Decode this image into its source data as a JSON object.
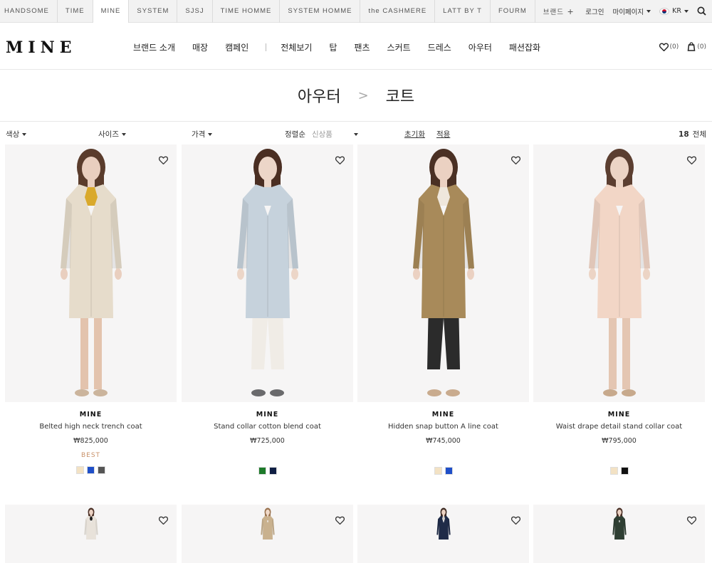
{
  "topbar": {
    "brands": [
      "HANDSOME",
      "TIME",
      "MINE",
      "SYSTEM",
      "SJSJ",
      "TIME HOMME",
      "SYSTEM HOMME",
      "the CASHMERE",
      "LATT BY T",
      "FOURM",
      "브랜드"
    ],
    "active_brand": "MINE",
    "login": "로그인",
    "mypage": "마이페이지",
    "lang": "KR"
  },
  "header": {
    "logo": "MINE",
    "nav_left": [
      "브랜드 소개",
      "매장",
      "캠페인"
    ],
    "nav_right": [
      "전체보기",
      "탑",
      "팬츠",
      "스커트",
      "드레스",
      "아우터",
      "패션잡화"
    ],
    "wish_count": "(0)",
    "cart_count": "(0)"
  },
  "breadcrumb": {
    "parent": "아우터",
    "separator": ">",
    "current": "코트"
  },
  "filters": {
    "color": "색상",
    "size": "사이즈",
    "price": "가격",
    "sort_label": "정렬순",
    "sort_value": "신상품",
    "reset": "초기화",
    "apply": "적용",
    "total_count": "18",
    "total_label": "전체"
  },
  "products": [
    {
      "brand": "MINE",
      "name": "Belted high neck trench coat",
      "price": "₩825,000",
      "badge": "BEST",
      "swatches": [
        "#f3e2c4",
        "#1f4fc8",
        "#555555"
      ],
      "garment": "#e6dccb",
      "inner": "#d9a92c",
      "legs": "#e3c3ad",
      "shoes": "#cbb49c",
      "skin": "#e9cfbf",
      "hair": "#5a3c2c",
      "pants": ""
    },
    {
      "brand": "MINE",
      "name": "Stand collar cotton blend coat",
      "price": "₩725,000",
      "badge": "",
      "swatches": [
        "#1d7a2a",
        "#0f1f44"
      ],
      "garment": "#c6d2dc",
      "inner": "#c6d2dc",
      "legs": "#f0ece6",
      "shoes": "#6a6a6c",
      "skin": "#ecd6c8",
      "hair": "#4a2e22",
      "pants": "#f0ece6"
    },
    {
      "brand": "MINE",
      "name": "Hidden snap button A line coat",
      "price": "₩745,000",
      "badge": "",
      "swatches": [
        "#f3e2c4",
        "#1f4fc8"
      ],
      "garment": "#a88a5a",
      "inner": "#efe7dc",
      "legs": "#2b2b2b",
      "shoes": "#c9ab8e",
      "skin": "#ebd1c2",
      "hair": "#4a3024",
      "pants": "#2b2b2b"
    },
    {
      "brand": "MINE",
      "name": "Waist drape detail stand collar coat",
      "price": "₩795,000",
      "badge": "",
      "swatches": [
        "#f3e2c4",
        "#111111"
      ],
      "garment": "#f2d6c6",
      "inner": "#f2d6c6",
      "legs": "#e4c6b2",
      "shoes": "#c7a98c",
      "skin": "#ecd4c5",
      "hair": "#5b3e30",
      "pants": ""
    },
    {
      "brand": "",
      "name": "",
      "price": "",
      "badge": "",
      "swatches": [],
      "garment": "#e8e2da",
      "inner": "#1b1b1b",
      "legs": "",
      "shoes": "",
      "skin": "#ecd3c4",
      "hair": "#4d3228",
      "pants": ""
    },
    {
      "brand": "",
      "name": "",
      "price": "",
      "badge": "",
      "swatches": [],
      "garment": "#c9b18e",
      "inner": "#c9b18e",
      "legs": "",
      "shoes": "",
      "skin": "#efd9c8",
      "hair": "#9a7350",
      "pants": ""
    },
    {
      "brand": "",
      "name": "",
      "price": "",
      "badge": "",
      "swatches": [],
      "garment": "#1f2b48",
      "inner": "#d8d4cf",
      "legs": "",
      "shoes": "",
      "skin": "#ecd2c2",
      "hair": "#3d2a22",
      "pants": ""
    },
    {
      "brand": "",
      "name": "",
      "price": "",
      "badge": "",
      "swatches": [],
      "garment": "#2f3f33",
      "inner": "#2f3f33",
      "legs": "",
      "shoes": "",
      "skin": "#ebd2c3",
      "hair": "#4a3026",
      "pants": ""
    }
  ]
}
